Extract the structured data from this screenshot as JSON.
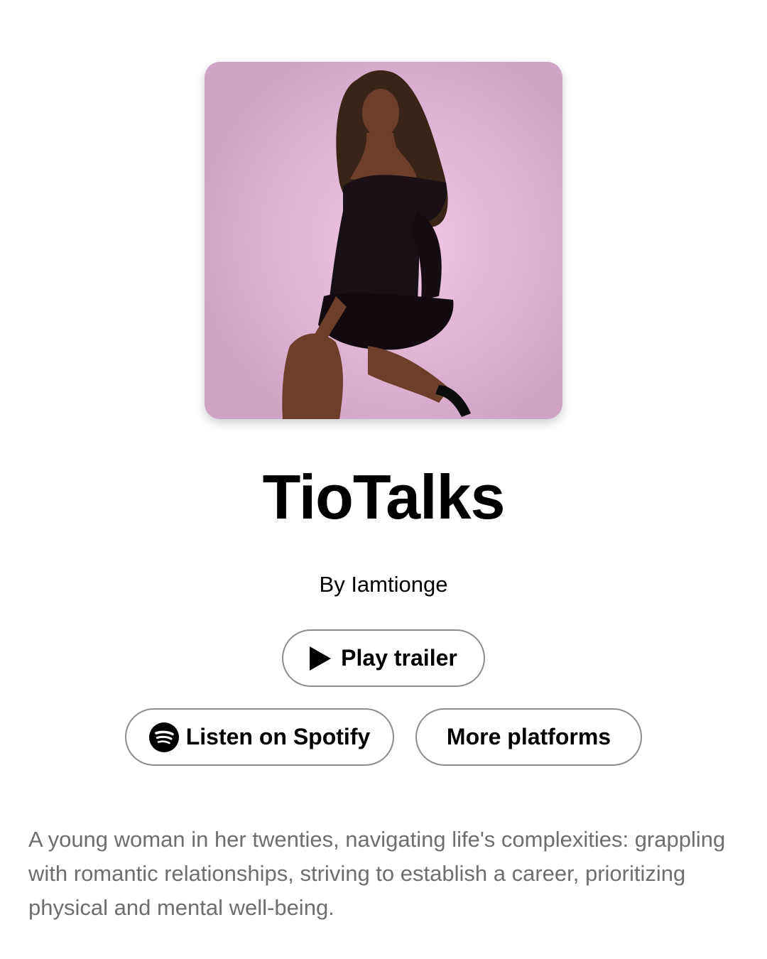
{
  "podcast": {
    "title": "TioTalks",
    "author": "By Iamtionge",
    "cover_icon": "podcast-cover-photo"
  },
  "buttons": {
    "play_trailer": "Play trailer",
    "listen_spotify": "Listen on Spotify",
    "more_platforms": "More platforms"
  },
  "icons": {
    "play": "play-icon",
    "spotify": "spotify-icon"
  },
  "description": "A young woman in her twenties, navigating life's complexities: grappling with romantic relationships, striving to establish a career, prioritizing physical and mental well-being.",
  "colors": {
    "cover_background": "#dcb3d2",
    "button_border": "#8c8c8c",
    "description_text": "#6e6e6e"
  }
}
